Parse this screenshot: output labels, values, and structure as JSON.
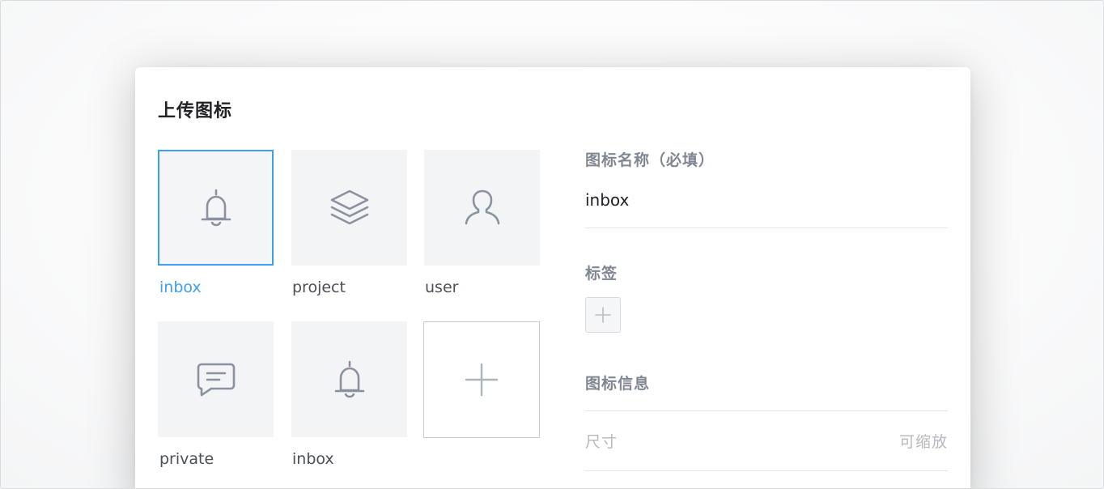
{
  "dialog": {
    "title": "上传图标"
  },
  "icons": [
    {
      "label": "inbox",
      "icon": "bell-icon",
      "selected": true
    },
    {
      "label": "project",
      "icon": "layers-icon",
      "selected": false
    },
    {
      "label": "user",
      "icon": "user-icon",
      "selected": false
    },
    {
      "label": "private",
      "icon": "message-icon",
      "selected": false
    },
    {
      "label": "inbox",
      "icon": "bell-icon",
      "selected": false
    }
  ],
  "add_icon": {
    "icon": "plus-icon"
  },
  "form": {
    "name_label": "图标名称（必填）",
    "name_value": "inbox",
    "tags_label": "标签",
    "info_label": "图标信息",
    "size_label": "尺寸",
    "size_value": "可缩放"
  },
  "colors": {
    "accent": "#3d9ff3",
    "icon_stroke": "#8a92a0",
    "tile_bg": "#f3f4f6"
  }
}
